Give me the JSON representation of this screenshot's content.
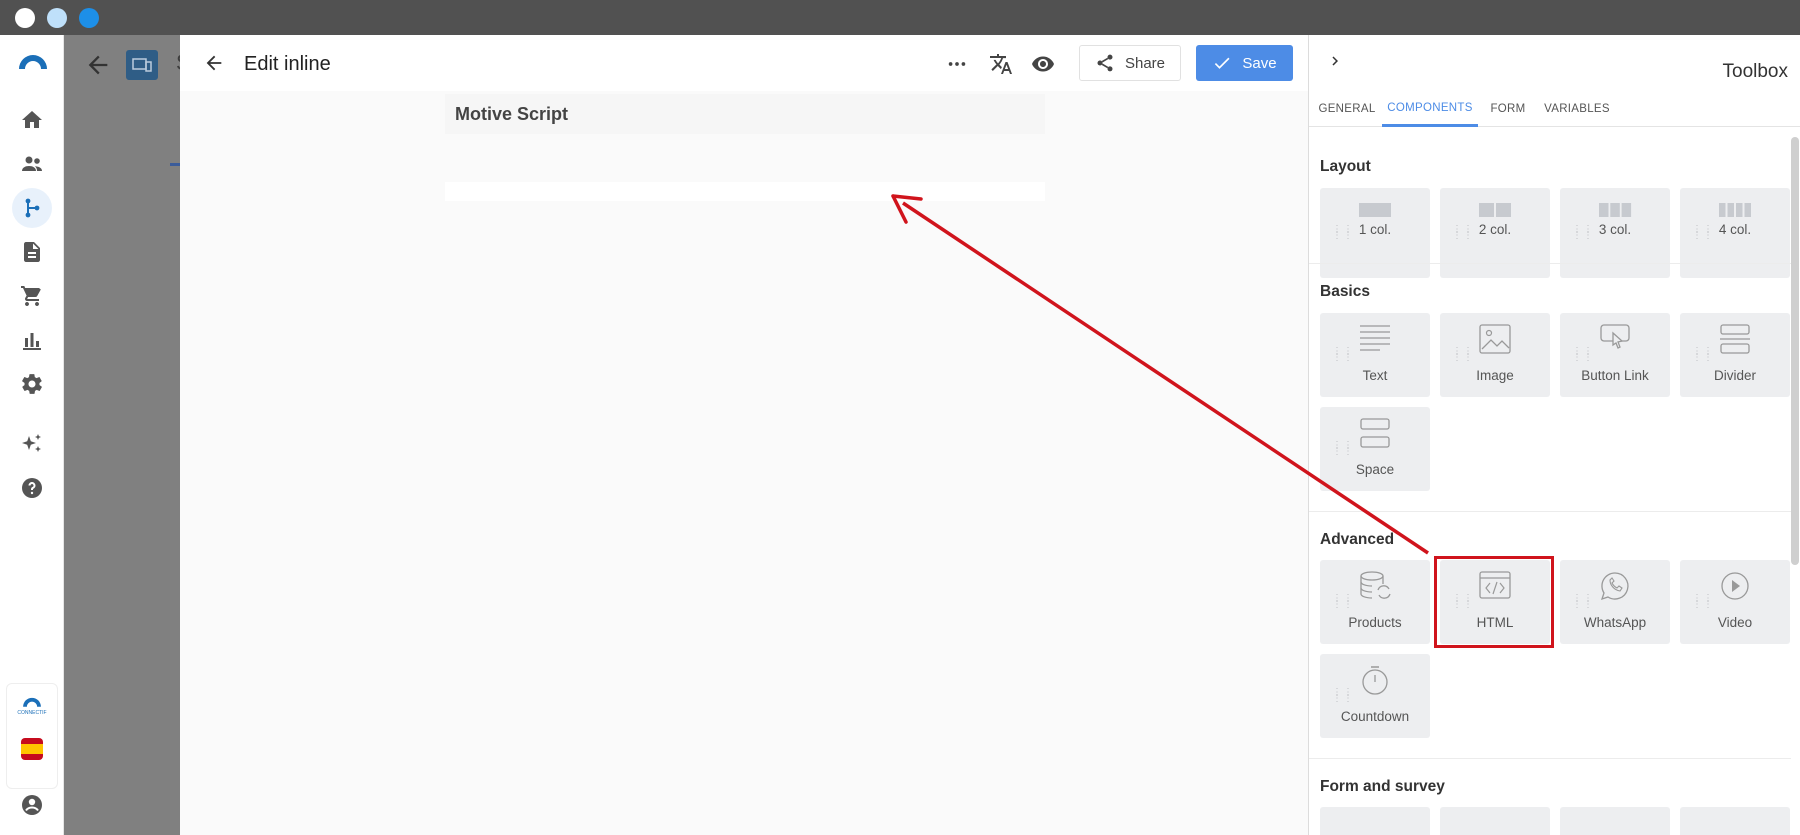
{
  "window": {
    "traffic_lights": [
      "#ffffff",
      "#bfe0fa",
      "#1d8fe8"
    ]
  },
  "left_nav": {
    "items": [
      "home-icon",
      "contacts-icon",
      "flows-icon",
      "documents-icon",
      "cart-icon",
      "analytics-icon",
      "settings-icon",
      "sparkle-icon",
      "help-icon"
    ],
    "active": "flows-icon",
    "brand_caption": "CONNECTIF"
  },
  "backdrop": {
    "partial_text": "S"
  },
  "editor": {
    "title": "Edit inline",
    "actions": [
      "more-icon",
      "translate-icon",
      "preview-eye-icon"
    ],
    "share_label": "Share",
    "save_label": "Save",
    "canvas_title": "Motive Script"
  },
  "toolbox": {
    "title": "Toolbox",
    "tabs": [
      {
        "label": "GENERAL"
      },
      {
        "label": "COMPONENTS",
        "active": true
      },
      {
        "label": "FORM"
      },
      {
        "label": "VARIABLES"
      }
    ],
    "sections": {
      "layout": {
        "title": "Layout",
        "items": [
          "1 col.",
          "2 col.",
          "3 col.",
          "4 col."
        ]
      },
      "basics": {
        "title": "Basics",
        "items": [
          "Text",
          "Image",
          "Button Link",
          "Divider",
          "Space"
        ]
      },
      "advanced": {
        "title": "Advanced",
        "items": [
          "Products",
          "HTML",
          "WhatsApp",
          "Video",
          "Countdown"
        ]
      },
      "form": {
        "title": "Form and survey"
      }
    }
  },
  "annotation": {
    "highlighted_item": "HTML",
    "color": "#d0141c"
  }
}
